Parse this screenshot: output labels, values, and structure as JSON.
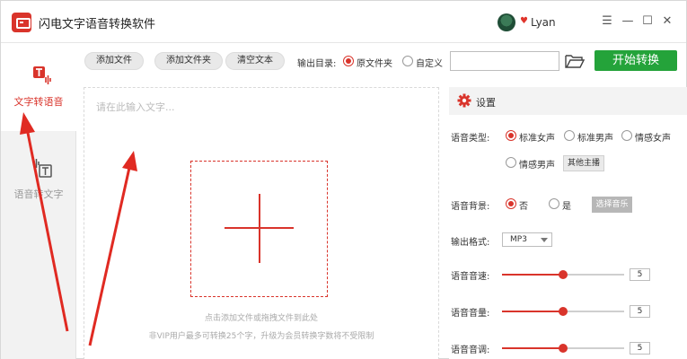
{
  "app": {
    "title": "闪电文字语音转换软件",
    "user": "Lyan"
  },
  "window": {
    "minimize": "—",
    "maximize": "☐",
    "close": "✕",
    "menu": "☰"
  },
  "sidebar": {
    "items": [
      {
        "label": "文字转语音",
        "active": true
      },
      {
        "label": "语音转文字",
        "active": false
      }
    ]
  },
  "toolbar": {
    "add_file": "添加文件",
    "add_folder": "添加文件夹",
    "clear_text": "清空文本",
    "output_label": "输出目录:",
    "output_options": [
      "原文件夹",
      "自定义"
    ],
    "output_selected": "原文件夹",
    "path_value": "",
    "start": "开始转换"
  },
  "editor": {
    "placeholder": "请在此输入文字...",
    "hint_main": "点击添加文件或拖拽文件到此处",
    "hint_vip": "非VIP用户最多可转换25个字，升级为会员转换字数将不受限制"
  },
  "settings": {
    "title": "设置",
    "voice_type_label": "语音类型:",
    "voice_types": [
      "标准女声",
      "标准男声",
      "情感女声",
      "情感男声"
    ],
    "voice_type_selected": "标准女声",
    "other_anchor": "其他主播",
    "bg_label": "语音背景:",
    "bg_options": [
      "否",
      "是"
    ],
    "bg_selected": "否",
    "choose_music": "选择音乐",
    "format_label": "输出格式:",
    "format_value": "MP3",
    "sliders": [
      {
        "label": "语音音速:",
        "value": "5",
        "level": 0.5
      },
      {
        "label": "语音音量:",
        "value": "5",
        "level": 0.5
      },
      {
        "label": "语音音调:",
        "value": "5",
        "level": 0.5
      }
    ]
  },
  "colors": {
    "accent": "#d9342b",
    "start_button": "#24a33a"
  }
}
